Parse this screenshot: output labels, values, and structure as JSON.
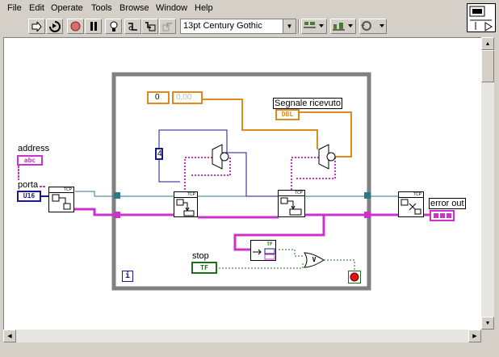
{
  "menu": [
    "File",
    "Edit",
    "Operate",
    "Tools",
    "Browse",
    "Window",
    "Help"
  ],
  "toolbar": {
    "font": "13pt Century Gothic"
  },
  "diagram": {
    "controls": {
      "address": {
        "label": "address",
        "type": "abc"
      },
      "porta": {
        "label": "porta",
        "type": "U16"
      },
      "stop": {
        "label": "stop",
        "type": "TF"
      }
    },
    "indicators": {
      "error_out": {
        "label": "error out"
      },
      "segnale": {
        "label": "Segnale ricevuto",
        "type": "DBL"
      }
    },
    "constants": {
      "int_value": "0",
      "dbl_value": "0,00",
      "num_4": "4"
    },
    "nodes": {
      "tcp_open": "TCP",
      "tcp_read1": "TCP",
      "tcp_read2": "TCP",
      "tcp_close": "TCP",
      "tf_node": "TF",
      "or_gate": "V"
    },
    "loop_index": "i"
  },
  "colors": {
    "orange_wire": "#e08a1e",
    "pink_wire": "#cc33cc",
    "blue_wire": "#1a1a8c",
    "teal_wire": "#2a7a8a",
    "green_wire": "#1e6e1e",
    "loop_border": "#808080"
  }
}
